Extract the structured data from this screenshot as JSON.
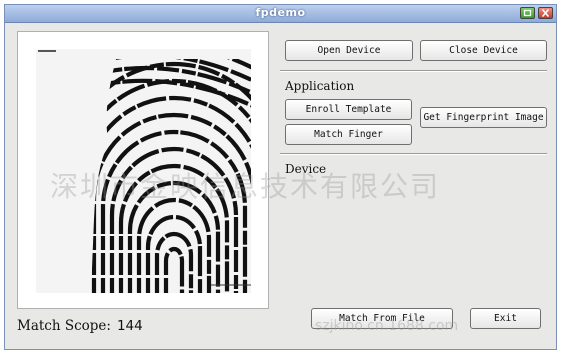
{
  "window": {
    "title": "fpdemo"
  },
  "buttons": {
    "open_device": "Open Device",
    "close_device": "Close Device",
    "enroll_template": "Enroll Template",
    "match_finger": "Match Finger",
    "get_fingerprint_image": "Get Fingerprint Image",
    "match_from_file": "Match From File",
    "exit": "Exit"
  },
  "sections": {
    "application": "Application",
    "device": "Device"
  },
  "status": {
    "label": "Match  Scope:",
    "value": "144"
  },
  "watermark": {
    "text": "深圳市金映信息技术有限公司",
    "url": "szjkino.cn.1688.com"
  },
  "icons": {
    "maximize": "maximize-icon",
    "close": "close-icon"
  },
  "colors": {
    "titlebar": "#8fabd8",
    "window_bg": "#e8e8e6",
    "close_button": "#c8382a",
    "maximize_button": "#3a9a2a"
  }
}
